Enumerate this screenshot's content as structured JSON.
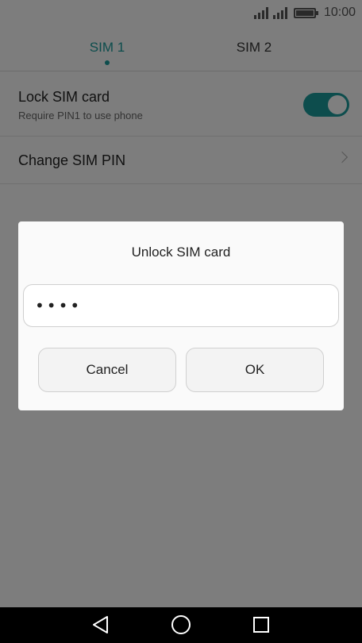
{
  "status_bar": {
    "time": "10:00",
    "signal_icons": [
      "signal-icon",
      "signal-icon"
    ],
    "battery_level": 1.0
  },
  "tabs": [
    {
      "label": "SIM 1",
      "selected": true
    },
    {
      "label": "SIM 2",
      "selected": false
    }
  ],
  "settings": {
    "lock_sim": {
      "title": "Lock SIM card",
      "subtitle": "Require PIN1 to use phone",
      "enabled": true
    },
    "change_pin": {
      "title": "Change SIM PIN"
    }
  },
  "dialog": {
    "title": "Unlock SIM card",
    "pin_value": "••••",
    "cancel_label": "Cancel",
    "ok_label": "OK"
  },
  "colors": {
    "accent": "#1a9a9a",
    "overlay": "rgba(0,0,0,0.5)"
  },
  "nav_bar": {
    "icons": [
      "back-icon",
      "home-icon",
      "recents-icon"
    ]
  }
}
